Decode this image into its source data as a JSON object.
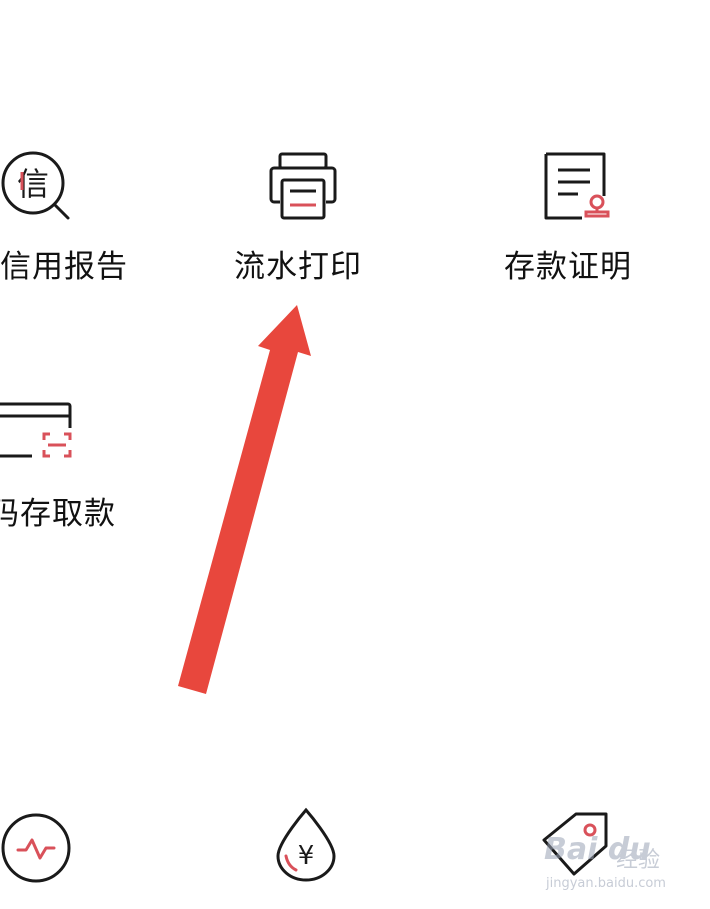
{
  "services": {
    "credit_report": {
      "label": "信用报告",
      "icon": "credit-report-search-icon"
    },
    "statement_print": {
      "label": "流水打印",
      "icon": "printer-icon"
    },
    "deposit_certificate": {
      "label": "存款证明",
      "icon": "certificate-stamp-icon"
    },
    "scan_deposit": {
      "label": "码存取款",
      "icon": "card-scan-icon"
    }
  },
  "bottom_icons": [
    {
      "icon": "pulse-circle-icon"
    },
    {
      "icon": "yuan-droplet-icon"
    },
    {
      "icon": "price-tag-icon"
    }
  ],
  "annotation": {
    "icon": "red-arrow-pointer",
    "color": "#e8473d"
  },
  "watermark": {
    "brand": "Bai du",
    "cn": "经验",
    "url": "jingyan.baidu.com"
  },
  "colors": {
    "accent": "#d9515a",
    "stroke": "#1a1a1a",
    "arrow": "#e8473d"
  }
}
